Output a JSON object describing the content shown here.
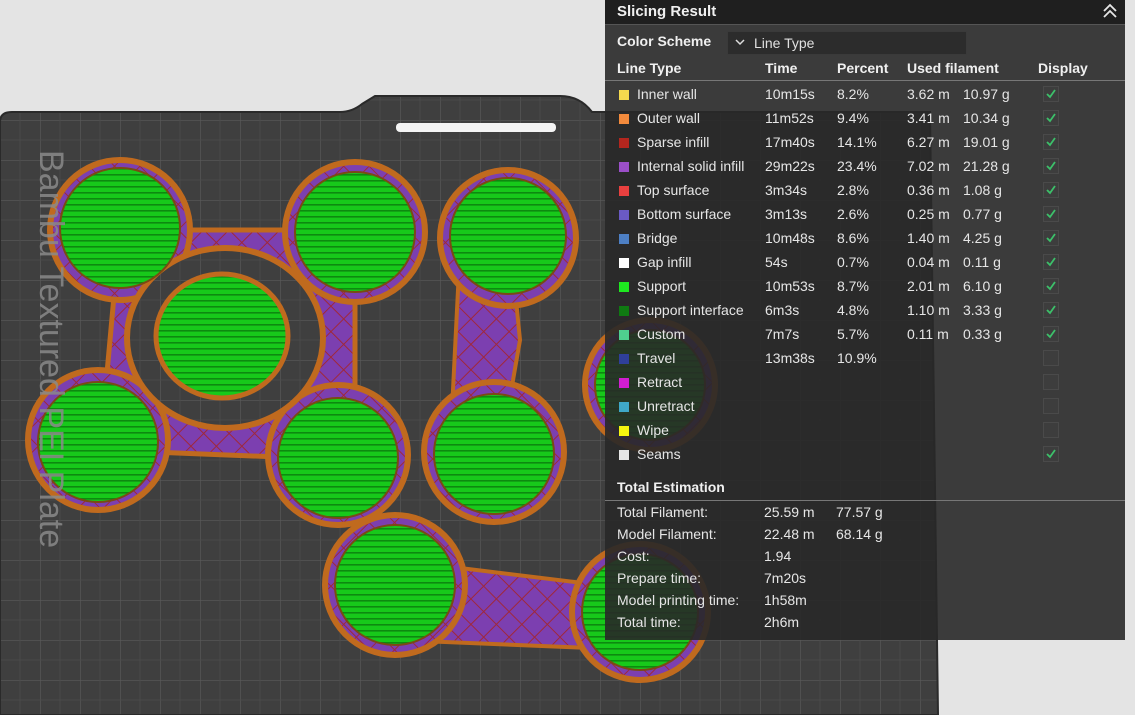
{
  "panel": {
    "title": "Slicing Result",
    "collapse_icon": "chevron-double-up-icon",
    "color_scheme_label": "Color Scheme",
    "color_scheme_value": "Line Type",
    "columns": [
      "Line Type",
      "Time",
      "Percent",
      "Used filament",
      "Display"
    ],
    "rows": [
      {
        "label": "Inner wall",
        "time": "10m15s",
        "percent": "8.2%",
        "length": "3.62 m",
        "weight": "10.97 g",
        "color": "#f5d94e",
        "display": true
      },
      {
        "label": "Outer wall",
        "time": "11m52s",
        "percent": "9.4%",
        "length": "3.41 m",
        "weight": "10.34 g",
        "color": "#f28a3c",
        "display": true
      },
      {
        "label": "Sparse infill",
        "time": "17m40s",
        "percent": "14.1%",
        "length": "6.27 m",
        "weight": "19.01 g",
        "color": "#b3261e",
        "display": true
      },
      {
        "label": "Internal solid infill",
        "time": "29m22s",
        "percent": "23.4%",
        "length": "7.02 m",
        "weight": "21.28 g",
        "color": "#9b4fc8",
        "display": true
      },
      {
        "label": "Top surface",
        "time": "3m34s",
        "percent": "2.8%",
        "length": "0.36 m",
        "weight": "1.08 g",
        "color": "#e8403f",
        "display": true
      },
      {
        "label": "Bottom surface",
        "time": "3m13s",
        "percent": "2.6%",
        "length": "0.25 m",
        "weight": "0.77 g",
        "color": "#6a5ac4",
        "display": true
      },
      {
        "label": "Bridge",
        "time": "10m48s",
        "percent": "8.6%",
        "length": "1.40 m",
        "weight": "4.25 g",
        "color": "#4d7fc4",
        "display": true
      },
      {
        "label": "Gap infill",
        "time": "54s",
        "percent": "0.7%",
        "length": "0.04 m",
        "weight": "0.11 g",
        "color": "#ffffff",
        "display": true
      },
      {
        "label": "Support",
        "time": "10m53s",
        "percent": "8.7%",
        "length": "2.01 m",
        "weight": "6.10 g",
        "color": "#1ee820",
        "display": true
      },
      {
        "label": "Support interface",
        "time": "6m3s",
        "percent": "4.8%",
        "length": "1.10 m",
        "weight": "3.33 g",
        "color": "#0f7a12",
        "display": true
      },
      {
        "label": "Custom",
        "time": "7m7s",
        "percent": "5.7%",
        "length": "0.11 m",
        "weight": "0.33 g",
        "color": "#4fcf8f",
        "display": true
      },
      {
        "label": "Travel",
        "time": "13m38s",
        "percent": "10.9%",
        "length": "",
        "weight": "",
        "color": "#2f3f9a",
        "display": false
      },
      {
        "label": "Retract",
        "time": "",
        "percent": "",
        "length": "",
        "weight": "",
        "color": "#d21ed2",
        "display": false
      },
      {
        "label": "Unretract",
        "time": "",
        "percent": "",
        "length": "",
        "weight": "",
        "color": "#3fa8c8",
        "display": false
      },
      {
        "label": "Wipe",
        "time": "",
        "percent": "",
        "length": "",
        "weight": "",
        "color": "#f5f50f",
        "display": false
      },
      {
        "label": "Seams",
        "time": "",
        "percent": "",
        "length": "",
        "weight": "",
        "color": "#e6e6e6",
        "display": true
      }
    ],
    "total_title": "Total Estimation",
    "totals": [
      {
        "label": "Total Filament:",
        "value": "25.59 m",
        "extra": "77.57 g"
      },
      {
        "label": "Model Filament:",
        "value": "22.48 m",
        "extra": "68.14 g"
      },
      {
        "label": "Cost:",
        "value": "1.94",
        "extra": ""
      },
      {
        "label": "Prepare time:",
        "value": "7m20s",
        "extra": ""
      },
      {
        "label": "Model printing time:",
        "value": "1h58m",
        "extra": ""
      },
      {
        "label": "Total time:",
        "value": "2h6m",
        "extra": ""
      }
    ]
  },
  "plate": {
    "label": "Bambu Textured PEI Plate"
  }
}
